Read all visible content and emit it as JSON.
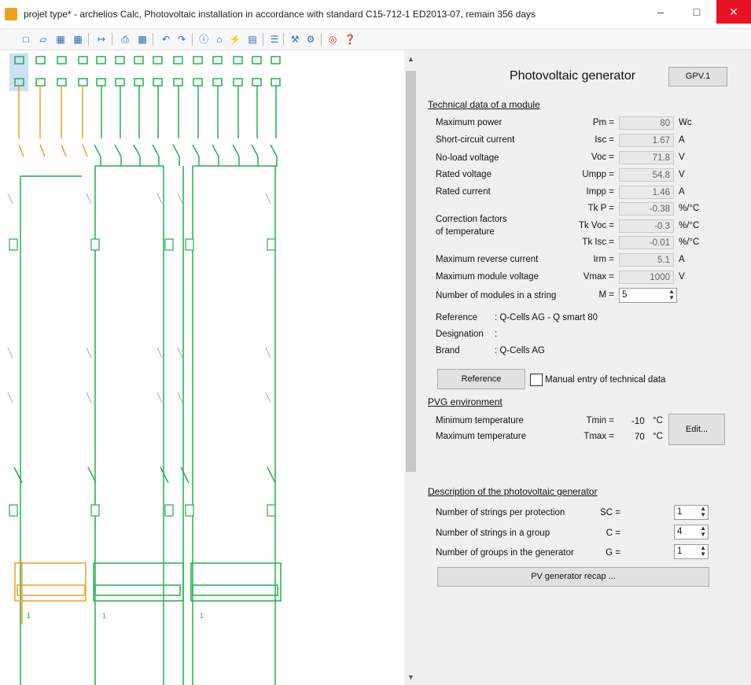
{
  "window": {
    "title": "projet type* - archelios Calc, Photovoltaic installation in accordance with standard C15-712-1 ED2013-07, remain 356 days",
    "minimize": "–",
    "maximize": "□",
    "close": "✕"
  },
  "toolbar": {
    "icons": [
      "new-icon",
      "open-icon",
      "save-icon",
      "save-as-icon",
      "export-icon",
      "print-icon",
      "export-image-icon",
      "undo-icon",
      "redo-icon",
      "info-icon",
      "home-icon",
      "lightning-icon",
      "chart-icon",
      "database-icon",
      "wrench-icon",
      "gear-icon",
      "help-lifebuoy-icon",
      "help-icon"
    ]
  },
  "panel": {
    "title": "Photovoltaic generator",
    "gpv_button": "GPV.1",
    "tech_section": "Technical data of a module",
    "rows": [
      {
        "label": "Maximum power",
        "symbol": "Pm =",
        "value": "80",
        "unit": "Wc"
      },
      {
        "label": "Short-circuit current",
        "symbol": "Isc =",
        "value": "1.67",
        "unit": "A"
      },
      {
        "label": "No-load voltage",
        "symbol": "Voc =",
        "value": "71.8",
        "unit": "V"
      },
      {
        "label": "Rated voltage",
        "symbol": "Umpp =",
        "value": "54.8",
        "unit": "V"
      },
      {
        "label": "Rated current",
        "symbol": "Impp =",
        "value": "1.46",
        "unit": "A"
      }
    ],
    "correction_label_1": "Correction factors",
    "correction_label_2": "of temperature",
    "correction": [
      {
        "symbol": "Tk P =",
        "value": "-0.38",
        "unit": "%/°C"
      },
      {
        "symbol": "Tk Voc =",
        "value": "-0.3",
        "unit": "%/°C"
      },
      {
        "symbol": "Tk Isc =",
        "value": "-0.01",
        "unit": "%/°C"
      }
    ],
    "rows2": [
      {
        "label": "Maximum reverse current",
        "symbol": "Irm =",
        "value": "5.1",
        "unit": "A"
      },
      {
        "label": "Maximum module voltage",
        "symbol": "Vmax =",
        "value": "1000",
        "unit": "V"
      }
    ],
    "modules_label": "Number of modules in a string",
    "modules_symbol": "M =",
    "modules_value": "5",
    "reference_label": "Reference",
    "reference_value": ":   Q-Cells AG - Q smart 80",
    "designation_label": "Designation",
    "designation_value": ":",
    "brand_label": "Brand",
    "brand_value": ":   Q-Cells AG",
    "reference_button": "Reference",
    "manual_entry": "Manual entry of technical data",
    "env_section": "PVG environment",
    "min_temp_label": "Minimum temperature",
    "min_temp_symbol": "Tmin =",
    "min_temp_value": "-10",
    "max_temp_label": "Maximum temperature",
    "max_temp_symbol": "Tmax =",
    "max_temp_value": "70",
    "temp_unit": "°C",
    "edit_button": "Edit...",
    "desc_section": "Description of the photovoltaic generator",
    "strings_protection_label": "Number of strings per protection",
    "strings_protection_symbol": "SC =",
    "strings_protection_value": "1",
    "strings_group_label": "Number of strings in a group",
    "strings_group_symbol": "C =",
    "strings_group_value": "4",
    "groups_label": "Number of groups in the generator",
    "groups_symbol": "G =",
    "groups_value": "1",
    "recap_button": "PV generator recap ...",
    "diagram_label": "1"
  },
  "colors": {
    "accent": "#2a6fb0",
    "wire_green": "#22b14c",
    "wire_orange": "#f0a020",
    "close_red": "#e81123"
  }
}
